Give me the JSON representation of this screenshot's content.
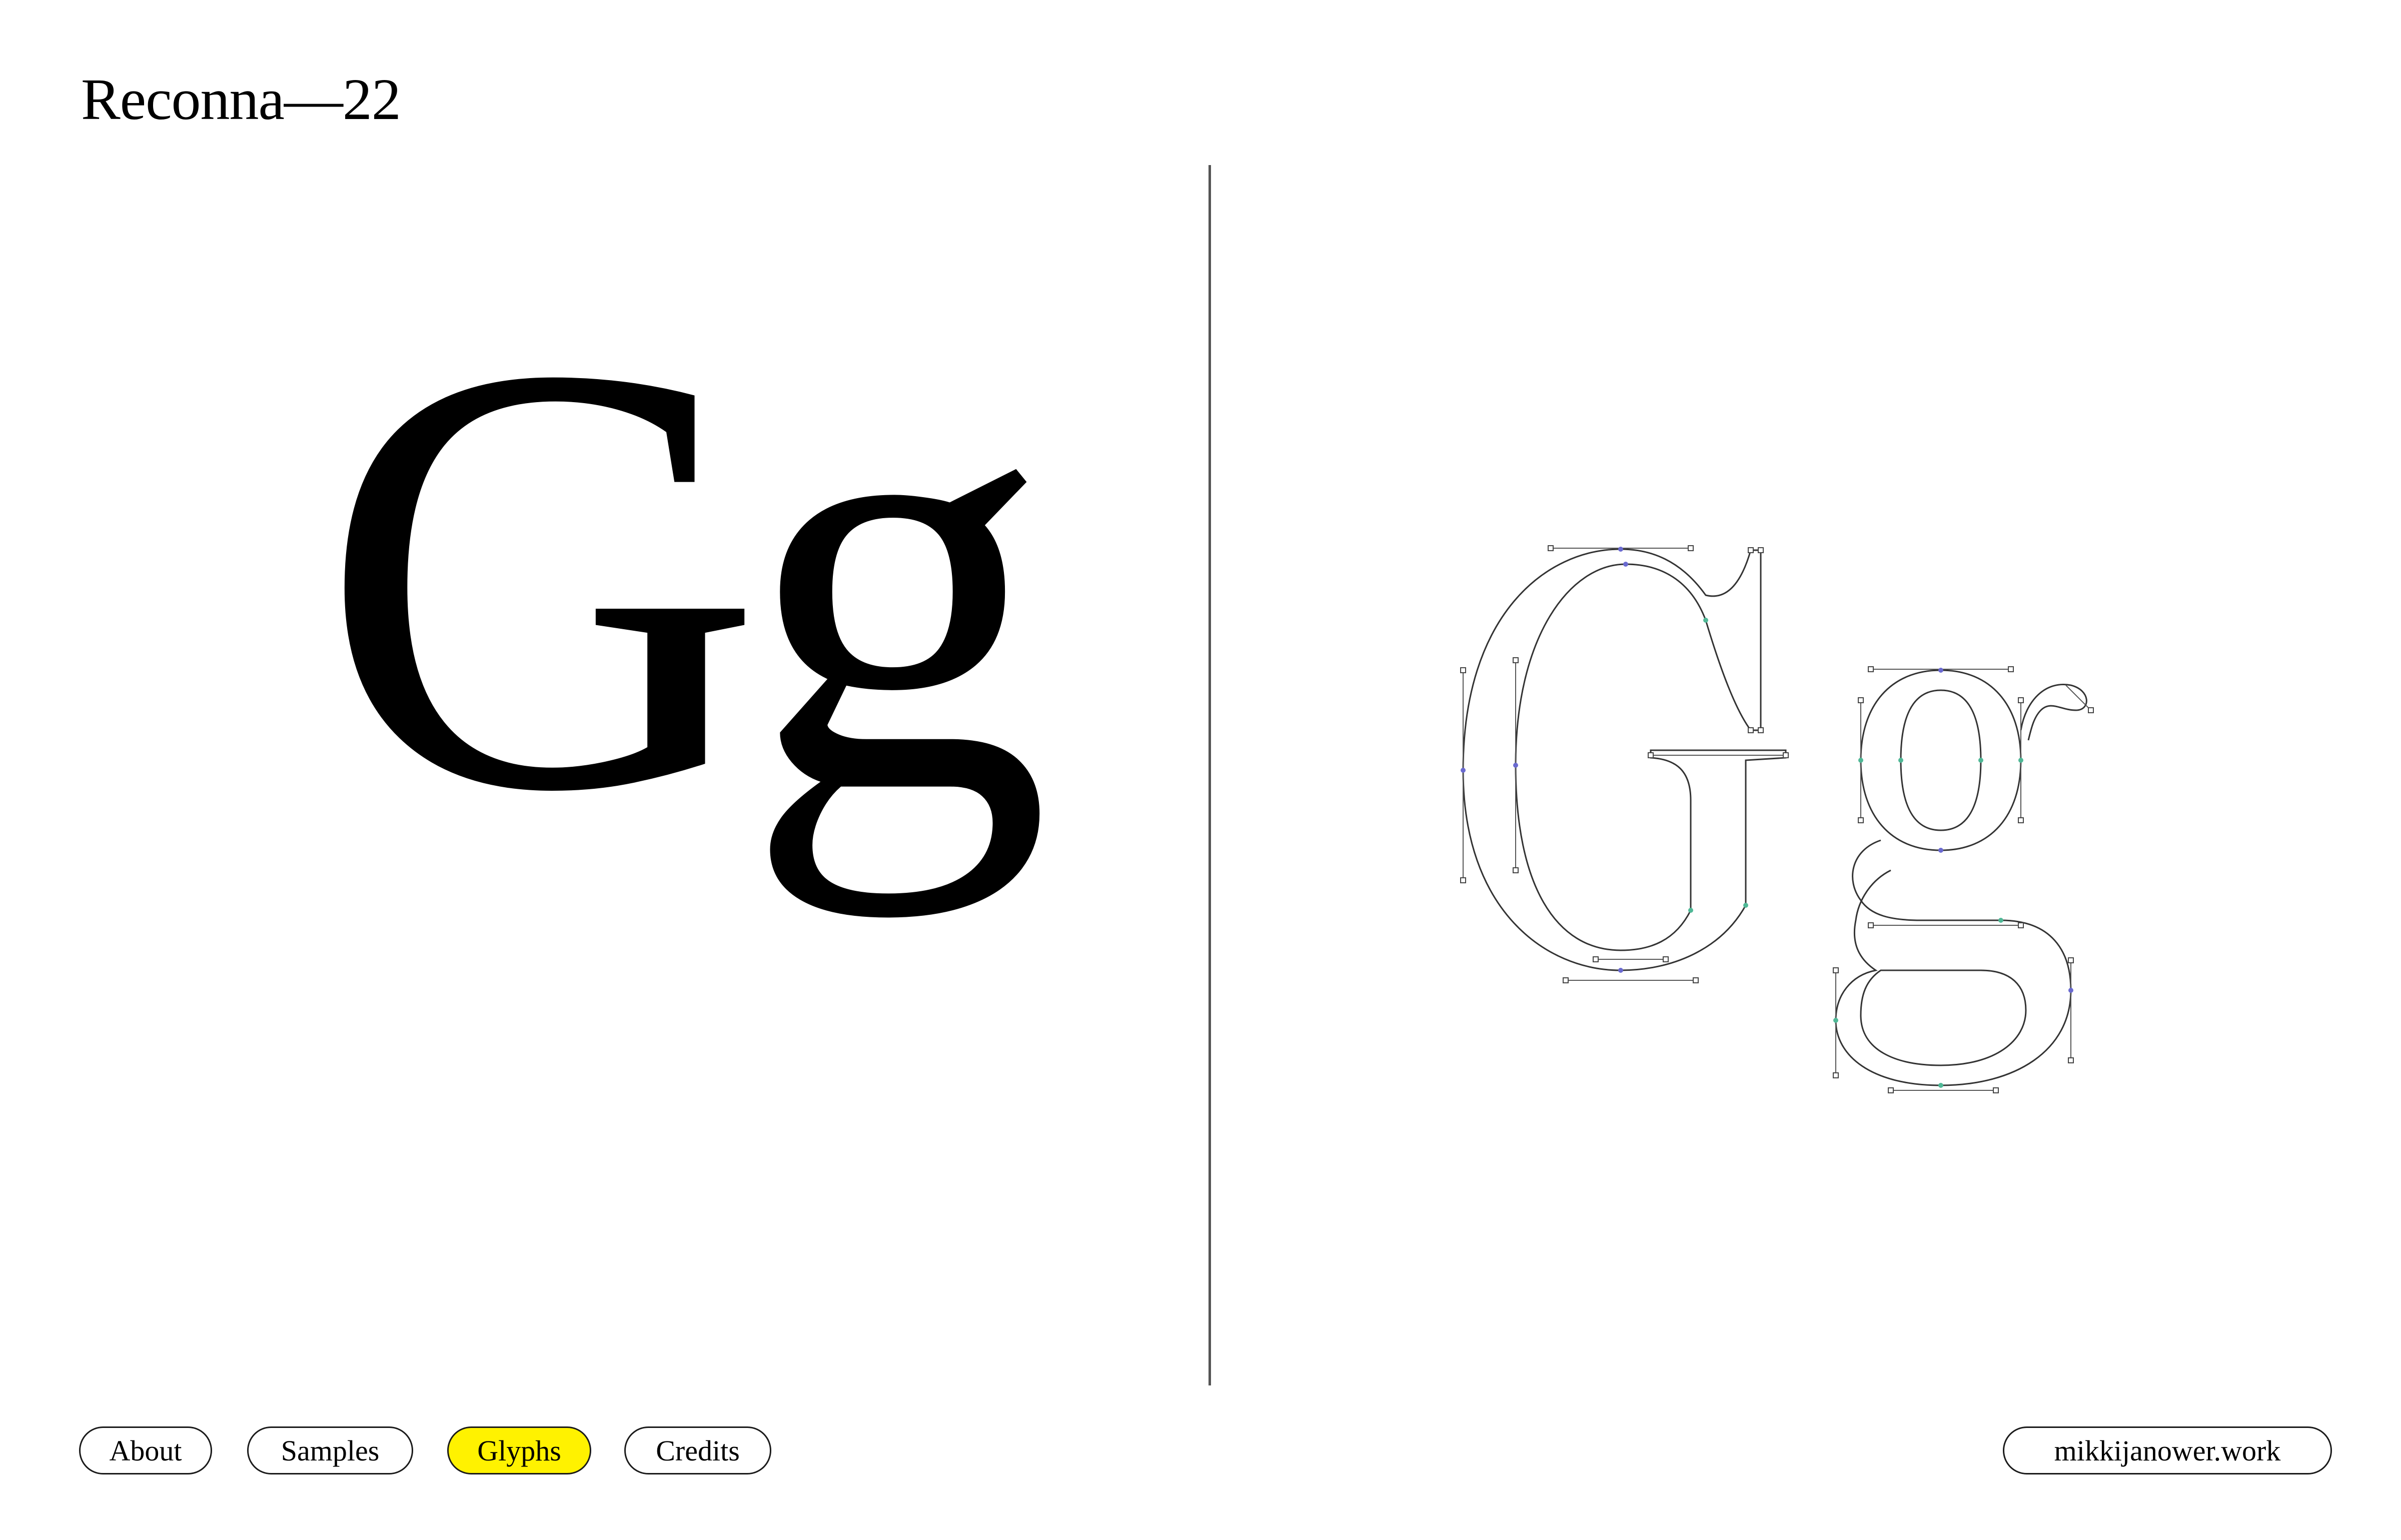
{
  "header": {
    "title": "Reconna—22"
  },
  "specimen": {
    "solid_glyphs": "Gg",
    "outline_glyphs": "Gg"
  },
  "nav": {
    "items": [
      {
        "label": "About",
        "active": false
      },
      {
        "label": "Samples",
        "active": false
      },
      {
        "label": "Glyphs",
        "active": true
      },
      {
        "label": "Credits",
        "active": false
      }
    ]
  },
  "footer": {
    "site_link": "mikkijanower.work"
  },
  "colors": {
    "accent": "#fff200",
    "text": "#000000",
    "background": "#ffffff",
    "outline_stroke": "#333333",
    "node_blue": "#6a6ad0",
    "node_green": "#4fb896"
  }
}
